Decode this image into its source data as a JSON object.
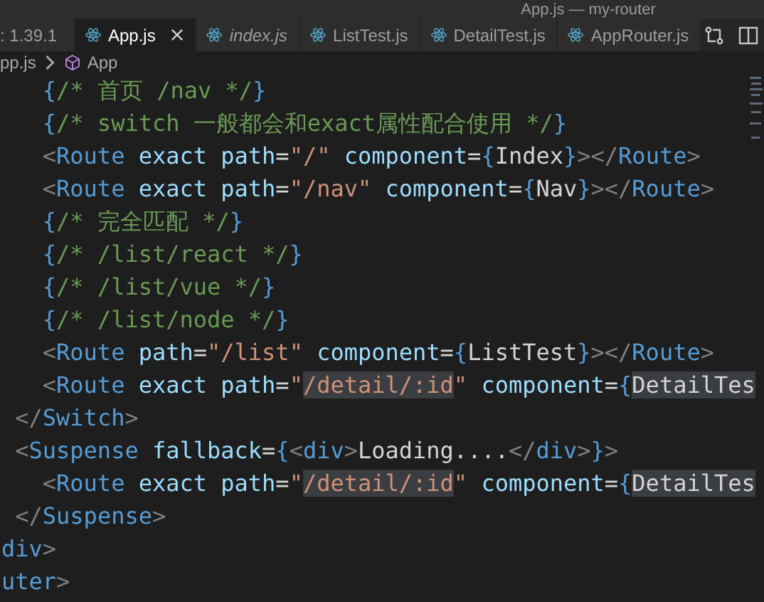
{
  "window": {
    "title": "App.js — my-router"
  },
  "tabs": [
    {
      "label": ": 1.39.1",
      "selected": false,
      "preview": false,
      "icon": false
    },
    {
      "label": "App.js",
      "selected": true,
      "preview": false,
      "icon": true,
      "close": true
    },
    {
      "label": "index.js",
      "selected": false,
      "preview": true,
      "icon": true,
      "close": false
    },
    {
      "label": "ListTest.js",
      "selected": false,
      "preview": false,
      "icon": true,
      "close": false
    },
    {
      "label": "DetailTest.js",
      "selected": false,
      "preview": false,
      "icon": true,
      "close": false
    },
    {
      "label": "AppRouter.js",
      "selected": false,
      "preview": false,
      "icon": true,
      "close": false
    }
  ],
  "breadcrumb": [
    "pp.js",
    "App"
  ],
  "code": [
    [
      {
        "text": "   {",
        "kind": "brace"
      },
      {
        "text": "/* 首页 /nav */",
        "kind": "comment"
      },
      {
        "text": "}",
        "kind": "brace"
      }
    ],
    [
      {
        "text": "   {",
        "kind": "brace"
      },
      {
        "text": "/* switch 一般都会和exact属性配合使用 */",
        "kind": "comment"
      },
      {
        "text": "}",
        "kind": "brace"
      }
    ],
    [
      {
        "text": "   <",
        "kind": "punct"
      },
      {
        "text": "Route",
        "kind": "tag"
      },
      {
        "text": " exact path",
        "kind": "attr"
      },
      {
        "text": "=",
        "kind": "plain"
      },
      {
        "text": "\"/\"",
        "kind": "string"
      },
      {
        "text": " component",
        "kind": "attr"
      },
      {
        "text": "=",
        "kind": "plain"
      },
      {
        "text": "{",
        "kind": "brace"
      },
      {
        "text": "Index",
        "kind": "plain"
      },
      {
        "text": "}",
        "kind": "brace"
      },
      {
        "text": "></",
        "kind": "punct"
      },
      {
        "text": "Route",
        "kind": "tag"
      },
      {
        "text": ">",
        "kind": "punct"
      }
    ],
    [
      {
        "text": "   <",
        "kind": "punct"
      },
      {
        "text": "Route",
        "kind": "tag"
      },
      {
        "text": " exact path",
        "kind": "attr"
      },
      {
        "text": "=",
        "kind": "plain"
      },
      {
        "text": "\"/nav\"",
        "kind": "string"
      },
      {
        "text": " component",
        "kind": "attr"
      },
      {
        "text": "=",
        "kind": "plain"
      },
      {
        "text": "{",
        "kind": "brace"
      },
      {
        "text": "Nav",
        "kind": "plain"
      },
      {
        "text": "}",
        "kind": "brace"
      },
      {
        "text": "></",
        "kind": "punct"
      },
      {
        "text": "Route",
        "kind": "tag"
      },
      {
        "text": ">",
        "kind": "punct"
      }
    ],
    [
      {
        "text": "   {",
        "kind": "brace"
      },
      {
        "text": "/* 完全匹配 */",
        "kind": "comment"
      },
      {
        "text": "}",
        "kind": "brace"
      }
    ],
    [
      {
        "text": "   {",
        "kind": "brace"
      },
      {
        "text": "/* /list/react */",
        "kind": "comment"
      },
      {
        "text": "}",
        "kind": "brace"
      }
    ],
    [
      {
        "text": "   {",
        "kind": "brace"
      },
      {
        "text": "/* /list/vue */",
        "kind": "comment"
      },
      {
        "text": "}",
        "kind": "brace"
      }
    ],
    [
      {
        "text": "   {",
        "kind": "brace"
      },
      {
        "text": "/* /list/node */",
        "kind": "comment"
      },
      {
        "text": "}",
        "kind": "brace"
      }
    ],
    [
      {
        "text": "   <",
        "kind": "punct"
      },
      {
        "text": "Route",
        "kind": "tag"
      },
      {
        "text": " path",
        "kind": "attr"
      },
      {
        "text": "=",
        "kind": "plain"
      },
      {
        "text": "\"/list\"",
        "kind": "string"
      },
      {
        "text": " component",
        "kind": "attr"
      },
      {
        "text": "=",
        "kind": "plain"
      },
      {
        "text": "{",
        "kind": "brace"
      },
      {
        "text": "ListTest",
        "kind": "plain"
      },
      {
        "text": "}",
        "kind": "brace"
      },
      {
        "text": "></",
        "kind": "punct"
      },
      {
        "text": "Route",
        "kind": "tag"
      },
      {
        "text": ">",
        "kind": "punct"
      }
    ],
    [
      {
        "text": "   <",
        "kind": "punct"
      },
      {
        "text": "Route",
        "kind": "tag"
      },
      {
        "text": " exact path",
        "kind": "attr"
      },
      {
        "text": "=",
        "kind": "plain"
      },
      {
        "text": "\"",
        "kind": "string"
      },
      {
        "text": "/detail/:id",
        "kind": "string",
        "highlighted": true
      },
      {
        "text": "\"",
        "kind": "string"
      },
      {
        "text": " component",
        "kind": "attr"
      },
      {
        "text": "=",
        "kind": "plain"
      },
      {
        "text": "{",
        "kind": "brace"
      },
      {
        "text": "DetailTes",
        "kind": "plain",
        "highlighted": true
      }
    ],
    [
      {
        "text": " </",
        "kind": "punct"
      },
      {
        "text": "Switch",
        "kind": "tag"
      },
      {
        "text": ">",
        "kind": "punct"
      }
    ],
    [
      {
        "text": " <",
        "kind": "punct"
      },
      {
        "text": "Suspense",
        "kind": "tag"
      },
      {
        "text": " fallback",
        "kind": "attr"
      },
      {
        "text": "=",
        "kind": "plain"
      },
      {
        "text": "{",
        "kind": "brace"
      },
      {
        "text": "<",
        "kind": "punct"
      },
      {
        "text": "div",
        "kind": "tag"
      },
      {
        "text": ">",
        "kind": "punct"
      },
      {
        "text": "Loading....",
        "kind": "plain"
      },
      {
        "text": "</",
        "kind": "punct"
      },
      {
        "text": "div",
        "kind": "tag"
      },
      {
        "text": ">",
        "kind": "punct"
      },
      {
        "text": "}",
        "kind": "brace"
      },
      {
        "text": ">",
        "kind": "punct"
      }
    ],
    [
      {
        "text": "   <",
        "kind": "punct"
      },
      {
        "text": "Route",
        "kind": "tag"
      },
      {
        "text": " exact path",
        "kind": "attr"
      },
      {
        "text": "=",
        "kind": "plain"
      },
      {
        "text": "\"",
        "kind": "string"
      },
      {
        "text": "/detail/:id",
        "kind": "string",
        "highlighted": true
      },
      {
        "text": "\"",
        "kind": "string"
      },
      {
        "text": " component",
        "kind": "attr"
      },
      {
        "text": "=",
        "kind": "plain"
      },
      {
        "text": "{",
        "kind": "brace"
      },
      {
        "text": "DetailTes",
        "kind": "plain",
        "highlighted": true
      }
    ],
    [
      {
        "text": " </",
        "kind": "punct"
      },
      {
        "text": "Suspense",
        "kind": "tag"
      },
      {
        "text": ">",
        "kind": "punct"
      }
    ],
    [
      {
        "text": "div",
        "kind": "tag"
      },
      {
        "text": ">",
        "kind": "punct"
      }
    ],
    [
      {
        "text": "uter",
        "kind": "tag"
      },
      {
        "text": ">",
        "kind": "punct"
      }
    ]
  ]
}
